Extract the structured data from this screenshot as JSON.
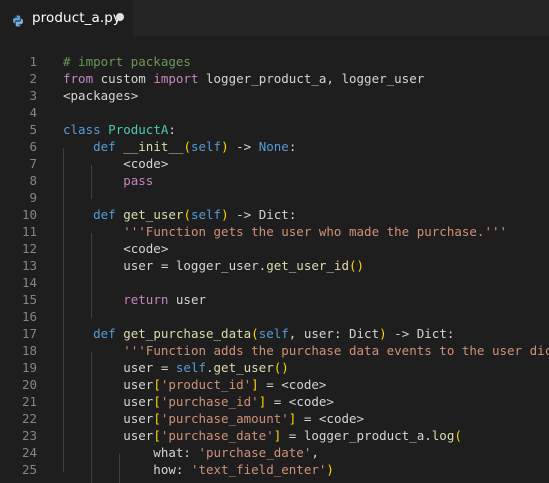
{
  "tab": {
    "filename": "product_a.py",
    "icon": "python-file-icon",
    "unsaved": true
  },
  "colors": {
    "background": "#1e1e1e",
    "comment": "#6a9955",
    "keyword_control": "#c586c0",
    "keyword": "#569cd6",
    "string": "#ce9178",
    "function": "#dcdcaa",
    "class": "#4ec9b0",
    "bracket": "#ffd700",
    "text": "#d4d4d4"
  },
  "lines": [
    {
      "n": "1",
      "tokens": [
        {
          "t": "# import packages",
          "c": "c"
        }
      ]
    },
    {
      "n": "2",
      "tokens": [
        {
          "t": "from",
          "c": "k"
        },
        {
          "t": " custom ",
          "c": "pl"
        },
        {
          "t": "import",
          "c": "k"
        },
        {
          "t": " logger_product_a, logger_user",
          "c": "pl"
        }
      ]
    },
    {
      "n": "3",
      "tokens": [
        {
          "t": "<packages>",
          "c": "pl"
        }
      ]
    },
    {
      "n": "4",
      "tokens": []
    },
    {
      "n": "5",
      "tokens": [
        {
          "t": "class",
          "c": "kw"
        },
        {
          "t": " ",
          "c": "pl"
        },
        {
          "t": "ProductA",
          "c": "cl"
        },
        {
          "t": ":",
          "c": "pl"
        }
      ]
    },
    {
      "n": "6",
      "tokens": [
        {
          "t": "    ",
          "c": "pl"
        },
        {
          "t": "def",
          "c": "kw"
        },
        {
          "t": " ",
          "c": "pl"
        },
        {
          "t": "__init__",
          "c": "fn"
        },
        {
          "t": "(",
          "c": "br"
        },
        {
          "t": "self",
          "c": "kw"
        },
        {
          "t": ")",
          "c": "br"
        },
        {
          "t": " -> ",
          "c": "pl"
        },
        {
          "t": "None",
          "c": "kw"
        },
        {
          "t": ":",
          "c": "pl"
        }
      ]
    },
    {
      "n": "7",
      "tokens": [
        {
          "t": "        <code>",
          "c": "pl"
        }
      ]
    },
    {
      "n": "8",
      "tokens": [
        {
          "t": "        ",
          "c": "pl"
        },
        {
          "t": "pass",
          "c": "k"
        }
      ]
    },
    {
      "n": "9",
      "tokens": []
    },
    {
      "n": "10",
      "tokens": [
        {
          "t": "    ",
          "c": "pl"
        },
        {
          "t": "def",
          "c": "kw"
        },
        {
          "t": " ",
          "c": "pl"
        },
        {
          "t": "get_user",
          "c": "fn"
        },
        {
          "t": "(",
          "c": "br"
        },
        {
          "t": "self",
          "c": "kw"
        },
        {
          "t": ")",
          "c": "br"
        },
        {
          "t": " -> Dict:",
          "c": "pl"
        }
      ]
    },
    {
      "n": "11",
      "tokens": [
        {
          "t": "        ",
          "c": "pl"
        },
        {
          "t": "'''Function gets the user who made the purchase.'''",
          "c": "s"
        }
      ]
    },
    {
      "n": "12",
      "tokens": [
        {
          "t": "        <code>",
          "c": "pl"
        }
      ]
    },
    {
      "n": "13",
      "tokens": [
        {
          "t": "        user = logger_user.",
          "c": "pl"
        },
        {
          "t": "get_user_id",
          "c": "fn"
        },
        {
          "t": "()",
          "c": "br"
        }
      ]
    },
    {
      "n": "14",
      "tokens": []
    },
    {
      "n": "15",
      "tokens": [
        {
          "t": "        ",
          "c": "pl"
        },
        {
          "t": "return",
          "c": "k"
        },
        {
          "t": " user",
          "c": "pl"
        }
      ]
    },
    {
      "n": "16",
      "tokens": []
    },
    {
      "n": "17",
      "tokens": [
        {
          "t": "    ",
          "c": "pl"
        },
        {
          "t": "def",
          "c": "kw"
        },
        {
          "t": " ",
          "c": "pl"
        },
        {
          "t": "get_purchase_data",
          "c": "fn"
        },
        {
          "t": "(",
          "c": "br"
        },
        {
          "t": "self",
          "c": "kw"
        },
        {
          "t": ", user: Dict",
          "c": "pl"
        },
        {
          "t": ")",
          "c": "br"
        },
        {
          "t": " -> Dict:",
          "c": "pl"
        }
      ]
    },
    {
      "n": "18",
      "tokens": [
        {
          "t": "        ",
          "c": "pl"
        },
        {
          "t": "'''Function adds the purchase data events to the user dict.'''",
          "c": "s"
        }
      ]
    },
    {
      "n": "19",
      "tokens": [
        {
          "t": "        user = ",
          "c": "pl"
        },
        {
          "t": "self",
          "c": "kw"
        },
        {
          "t": ".",
          "c": "pl"
        },
        {
          "t": "get_user",
          "c": "fn"
        },
        {
          "t": "()",
          "c": "br"
        }
      ]
    },
    {
      "n": "20",
      "tokens": [
        {
          "t": "        user",
          "c": "pl"
        },
        {
          "t": "[",
          "c": "br"
        },
        {
          "t": "'product_id'",
          "c": "s"
        },
        {
          "t": "]",
          "c": "br"
        },
        {
          "t": " = <code>",
          "c": "pl"
        }
      ]
    },
    {
      "n": "21",
      "tokens": [
        {
          "t": "        user",
          "c": "pl"
        },
        {
          "t": "[",
          "c": "br"
        },
        {
          "t": "'purchase_id'",
          "c": "s"
        },
        {
          "t": "]",
          "c": "br"
        },
        {
          "t": " = <code>",
          "c": "pl"
        }
      ]
    },
    {
      "n": "22",
      "tokens": [
        {
          "t": "        user",
          "c": "pl"
        },
        {
          "t": "[",
          "c": "br"
        },
        {
          "t": "'purchase_amount'",
          "c": "s"
        },
        {
          "t": "]",
          "c": "br"
        },
        {
          "t": " = <code>",
          "c": "pl"
        }
      ]
    },
    {
      "n": "23",
      "tokens": [
        {
          "t": "        user",
          "c": "pl"
        },
        {
          "t": "[",
          "c": "br"
        },
        {
          "t": "'purchase_date'",
          "c": "s"
        },
        {
          "t": "]",
          "c": "br"
        },
        {
          "t": " = logger_product_a.",
          "c": "pl"
        },
        {
          "t": "log",
          "c": "fn"
        },
        {
          "t": "(",
          "c": "br"
        }
      ]
    },
    {
      "n": "24",
      "tokens": [
        {
          "t": "            what: ",
          "c": "pl"
        },
        {
          "t": "'purchase_date'",
          "c": "s"
        },
        {
          "t": ",",
          "c": "pl"
        }
      ]
    },
    {
      "n": "25",
      "tokens": [
        {
          "t": "            how: ",
          "c": "pl"
        },
        {
          "t": "'text_field_enter'",
          "c": "s"
        },
        {
          "t": ")",
          "c": "br"
        }
      ]
    }
  ]
}
